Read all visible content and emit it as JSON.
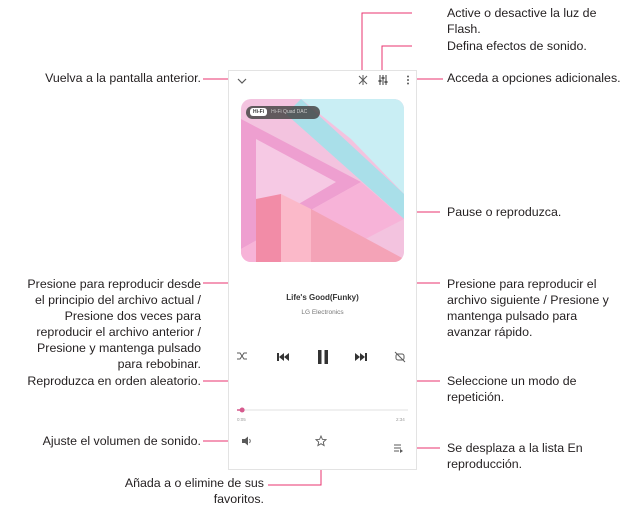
{
  "annotations": {
    "back": "Vuelva a la pantalla anterior.",
    "flash": "Active o desactive la luz de\nFlash.",
    "sound_effects": "Defina efectos de sonido.",
    "more_options": "Acceda a opciones adicionales.",
    "pause_play": "Pause o reproduzca.",
    "previous": "Presione para reproducir desde\nel principio del archivo actual /\nPresione dos veces para\nreproducir el archivo anterior /\nPresione y mantenga pulsado\npara rebobinar.",
    "next": "Presione para reproducir el\narchivo siguiente / Presione y\nmantenga pulsado para\navanzar rápido.",
    "shuffle": "Reproduzca en orden aleatorio.",
    "repeat": "Seleccione un modo de\nrepetición.",
    "volume": "Ajuste el volumen de sonido.",
    "playlist": "Se desplaza a la lista En\nreproducción.",
    "favorite": "Añada a o elimine de sus\nfavoritos."
  },
  "player": {
    "hifi_tag": "Hi-Fi",
    "hifi_text": "Hi-Fi Quad DAC",
    "song_title": "Life's Good(Funky)",
    "artist": "LG Electronics",
    "time_elapsed": "0:05",
    "time_total": "2:34",
    "progress": 0.03
  },
  "colors": {
    "leader": "#e8336f",
    "icon": "#5a5a5a",
    "cover_pink": "#f0a6cf",
    "cover_cyan": "#bfe9f0",
    "cover_rose": "#f4a3b7"
  }
}
